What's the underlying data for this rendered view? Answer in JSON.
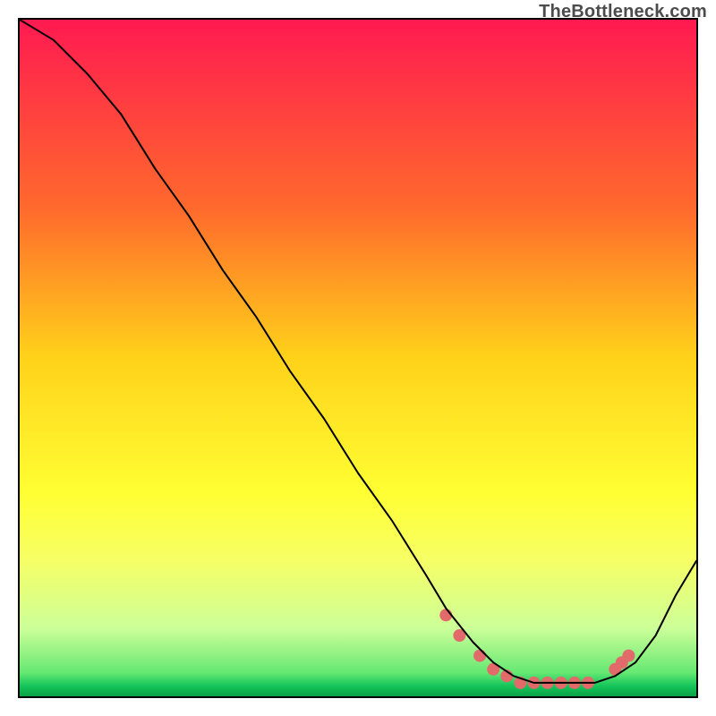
{
  "watermark": "TheBottleneck.com",
  "chart_data": {
    "type": "line",
    "title": "",
    "xlabel": "",
    "ylabel": "",
    "xlim": [
      0,
      100
    ],
    "ylim": [
      0,
      100
    ],
    "grid": false,
    "gradient_stops": [
      {
        "offset": 0.0,
        "color": "#ff1a51"
      },
      {
        "offset": 0.28,
        "color": "#ff6a2c"
      },
      {
        "offset": 0.5,
        "color": "#ffd21a"
      },
      {
        "offset": 0.7,
        "color": "#ffff33"
      },
      {
        "offset": 0.8,
        "color": "#f6ff66"
      },
      {
        "offset": 0.9,
        "color": "#ccff99"
      },
      {
        "offset": 0.965,
        "color": "#66e873"
      },
      {
        "offset": 0.985,
        "color": "#14c45a"
      },
      {
        "offset": 1.0,
        "color": "#0aa344"
      }
    ],
    "series": [
      {
        "name": "curve",
        "stroke": "#000000",
        "stroke_width": 2,
        "x": [
          0,
          5,
          10,
          15,
          20,
          25,
          30,
          35,
          40,
          45,
          50,
          55,
          60,
          63,
          67,
          70,
          73,
          76,
          79,
          82,
          85,
          88,
          91,
          94,
          97,
          100
        ],
        "y": [
          100,
          97,
          92,
          86,
          78,
          71,
          63,
          56,
          48,
          41,
          33,
          26,
          18,
          13,
          8,
          5,
          3,
          2,
          2,
          2,
          2,
          3,
          5,
          9,
          15,
          20
        ]
      }
    ],
    "markers": {
      "name": "highlight-points",
      "color": "#e26a6a",
      "radius": 7,
      "x": [
        63,
        65,
        68,
        70,
        72,
        74,
        76,
        78,
        80,
        82,
        84,
        88,
        89,
        90
      ],
      "y": [
        12,
        9,
        6,
        4,
        3,
        2,
        2,
        2,
        2,
        2,
        2,
        4,
        5,
        6
      ]
    }
  }
}
